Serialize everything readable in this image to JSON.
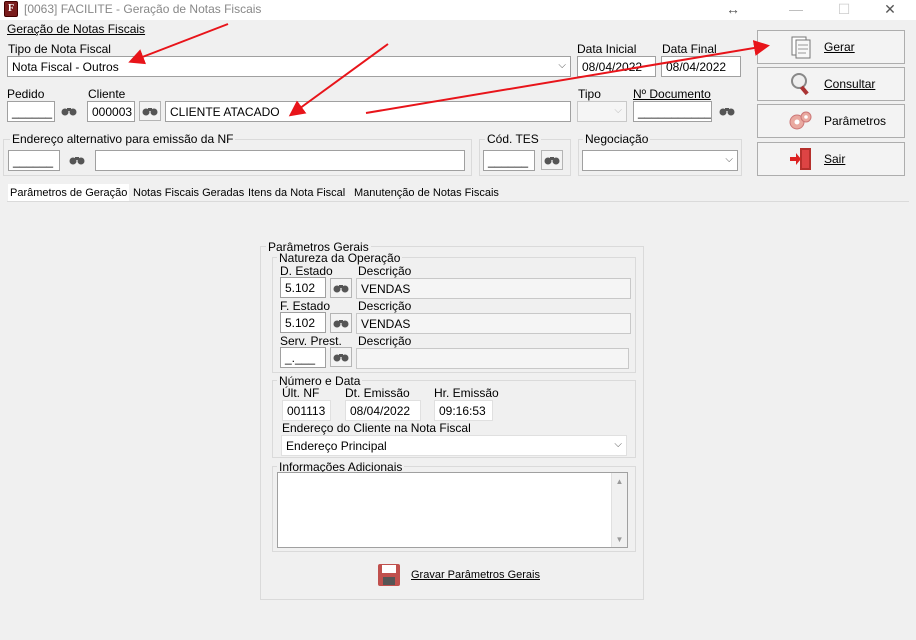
{
  "window": {
    "title": "[0063] FACILITE - Geração de Notas Fiscais",
    "icon_letter": "F",
    "controls": [
      "↔",
      "—",
      "☐",
      "✕"
    ]
  },
  "header": {
    "group_label": "Geração de Notas Fiscais"
  },
  "form": {
    "tipo_label": "Tipo de Nota Fiscal",
    "tipo_value": "Nota Fiscal - Outros",
    "data_inicial_label": "Data Inicial",
    "data_inicial_value": "08/04/2022",
    "data_final_label": "Data Final",
    "data_final_value": "08/04/2022",
    "pedido_label": "Pedido",
    "pedido_value": "______",
    "cliente_label": "Cliente",
    "cliente_code": "000003",
    "cliente_name": "CLIENTE ATACADO",
    "tipo2_label": "Tipo",
    "ndoc_label": "Nº Documento",
    "ndoc_value": "___________",
    "endereco_alt_label": "Endereço alternativo para emissão da NF",
    "endereco_alt_code": "______",
    "cod_tes_label": "Cód. TES",
    "cod_tes_value": "______",
    "negociacao_label": "Negociação"
  },
  "buttons": {
    "gerar": "Gerar",
    "consultar": "Consultar",
    "parametros": "Parâmetros",
    "sair": "Sair"
  },
  "tabs": [
    "Parâmetros de Geração",
    "Notas Fiscais Geradas",
    "Itens da Nota Fiscal",
    "Manutenção de Notas Fiscais"
  ],
  "params": {
    "group_label": "Parâmetros Gerais",
    "natureza_label": "Natureza da Operação",
    "d_estado_label": "D. Estado",
    "d_estado_code": "5.102",
    "d_estado_desc_label": "Descrição",
    "d_estado_desc": "VENDAS",
    "f_estado_label": "F. Estado",
    "f_estado_code": "5.102",
    "f_estado_desc_label": "Descrição",
    "f_estado_desc": "VENDAS",
    "serv_label": "Serv. Prest.",
    "serv_code": "_.___",
    "serv_desc_label": "Descrição",
    "numero_label": "Número e Data",
    "ult_nf_label": "Últ. NF",
    "ult_nf_value": "001113",
    "dt_emissao_label": "Dt. Emissão",
    "dt_emissao_value": "08/04/2022",
    "hr_emissao_label": "Hr. Emissão",
    "hr_emissao_value": "09:16:53",
    "endereco_cliente_label": "Endereço do Cliente na Nota Fiscal",
    "endereco_cliente_value": "Endereço Principal",
    "info_label": "Informações Adicionais",
    "gravar_label": "Gravar Parâmetros Gerais"
  },
  "colors": {
    "annotation_arrow": "#e8141a"
  }
}
